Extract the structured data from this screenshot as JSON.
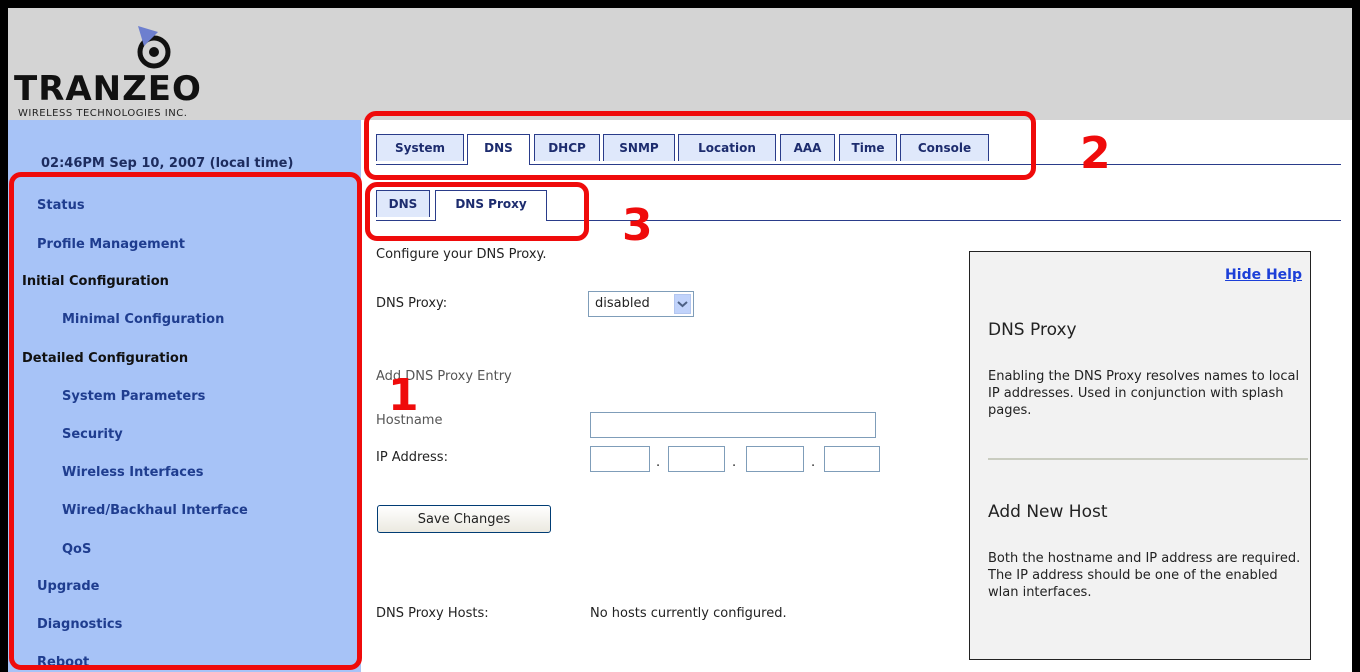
{
  "header": {
    "brand": "TRANZEO",
    "tagline": "WIRELESS TECHNOLOGIES INC."
  },
  "sidebar": {
    "clock": "02:46PM Sep 10, 2007 (local time)",
    "items": [
      {
        "label": "Status"
      },
      {
        "label": "Profile Management"
      },
      {
        "label": "Initial Configuration"
      },
      {
        "label": "Minimal Configuration"
      },
      {
        "label": "Detailed Configuration"
      },
      {
        "label": "System Parameters"
      },
      {
        "label": "Security"
      },
      {
        "label": "Wireless Interfaces"
      },
      {
        "label": "Wired/Backhaul Interface"
      },
      {
        "label": "QoS"
      },
      {
        "label": "Upgrade"
      },
      {
        "label": "Diagnostics"
      },
      {
        "label": "Reboot"
      }
    ]
  },
  "main_tabs": {
    "items": [
      {
        "label": "System"
      },
      {
        "label": "DNS"
      },
      {
        "label": "DHCP"
      },
      {
        "label": "SNMP"
      },
      {
        "label": "Location"
      },
      {
        "label": "AAA"
      },
      {
        "label": "Time"
      },
      {
        "label": "Console"
      }
    ],
    "active": "DNS"
  },
  "sub_tabs": {
    "items": [
      {
        "label": "DNS"
      },
      {
        "label": "DNS Proxy"
      }
    ],
    "active": "DNS Proxy"
  },
  "content": {
    "intro": "Configure your DNS Proxy.",
    "dns_proxy_label": "DNS Proxy:",
    "dns_proxy_value": "disabled",
    "add_entry_heading": "Add DNS Proxy Entry",
    "hostname_label": "Hostname",
    "hostname_value": "",
    "ip_label": "IP Address:",
    "ip_octets": [
      "",
      "",
      "",
      ""
    ],
    "save_button": "Save Changes",
    "hosts_label": "DNS Proxy Hosts:",
    "hosts_value": "No hosts currently configured."
  },
  "help": {
    "hide_link": "Hide Help",
    "section1_title": "DNS Proxy",
    "section1_text": "Enabling the DNS Proxy resolves names to local IP addresses. Used in conjunction with splash pages.",
    "section2_title": "Add New Host",
    "section2_text": "Both the hostname and IP address are required. The IP address should be one of the enabled wlan interfaces."
  },
  "annotations": {
    "labels": [
      "1",
      "2",
      "3"
    ],
    "color": "#ef0b0b"
  },
  "colors": {
    "sidebar_bg": "#a7c3f7",
    "header_bg": "#d4d4d4",
    "nav_link": "#1f3d8f",
    "help_link": "#1c3fd8"
  }
}
